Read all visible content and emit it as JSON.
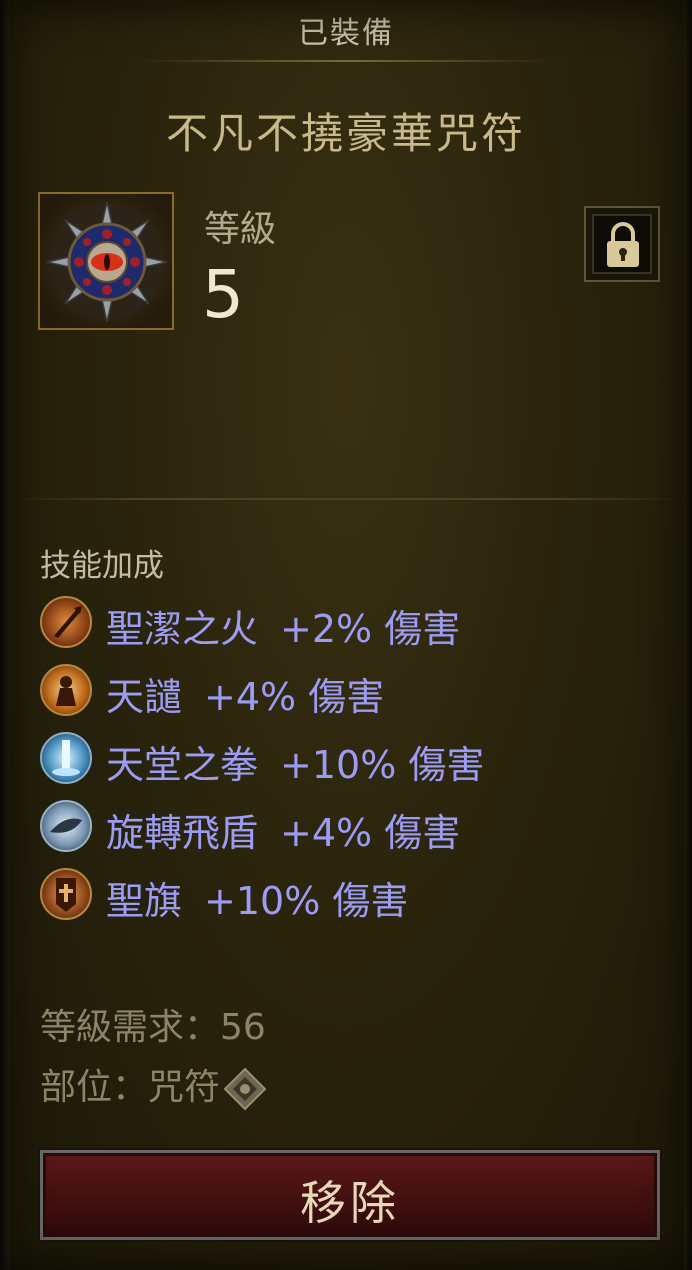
{
  "header": {
    "status": "已裝備"
  },
  "item": {
    "name": "不凡不撓豪華咒符",
    "icon": "amulet-icon",
    "level_label": "等級",
    "level_value": "5",
    "lock_icon": "lock-icon"
  },
  "skills": {
    "title": "技能加成",
    "items": [
      {
        "name": "聖潔之火",
        "bonus": "+2% 傷害",
        "icon": "holy-fire-icon"
      },
      {
        "name": "天譴",
        "bonus": "+4% 傷害",
        "icon": "wrath-icon"
      },
      {
        "name": "天堂之拳",
        "bonus": "+10% 傷害",
        "icon": "fist-of-heavens-icon"
      },
      {
        "name": "旋轉飛盾",
        "bonus": "+4% 傷害",
        "icon": "spinning-shield-icon"
      },
      {
        "name": "聖旗",
        "bonus": "+10% 傷害",
        "icon": "banner-icon"
      }
    ]
  },
  "requirements": {
    "level_req": "等級需求：56",
    "slot": "部位：咒符",
    "slot_icon": "amulet-slot-icon"
  },
  "actions": {
    "remove_label": "移除"
  },
  "colors": {
    "skill_text": "#9c9cf4",
    "button_red": "#4a1212",
    "item_name": "#c9b88a"
  }
}
